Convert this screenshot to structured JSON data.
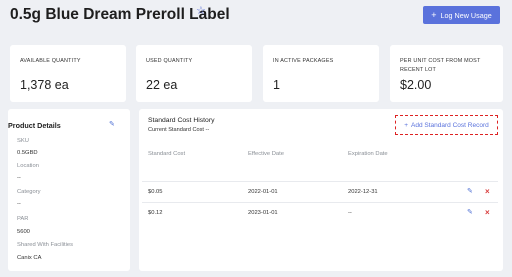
{
  "header": {
    "title": "0.5g Blue Dream Preroll Label",
    "star_icon": "star-outline-icon",
    "log_button_label": "Log New Usage"
  },
  "stats": [
    {
      "label": "AVAILABLE QUANTITY",
      "value": "1,378 ea"
    },
    {
      "label": "USED QUANTITY",
      "value": "22 ea"
    },
    {
      "label": "IN ACTIVE PACKAGES",
      "value": "1"
    },
    {
      "label": "PER UNIT COST FROM MOST RECENT LOT",
      "value": "$2.00"
    }
  ],
  "product_details": {
    "title": "Product Details",
    "fields": [
      {
        "label": "SKU",
        "value": "0.5GBD"
      },
      {
        "label": "Location",
        "value": "--"
      },
      {
        "label": "Category",
        "value": "--"
      },
      {
        "label": "PAR",
        "value": "5600"
      },
      {
        "label": "Shared With Facilities",
        "value": "Canix CA"
      }
    ]
  },
  "cost_history": {
    "title": "Standard Cost History",
    "subtitle": "Current Standard Cost --",
    "add_button_label": "Add Standard Cost Record",
    "columns": [
      "Standard Cost",
      "Effective Date",
      "Expiration Date"
    ],
    "rows": [
      {
        "cost": "$0.05",
        "effective": "2022-01-01",
        "expiration": "2022-12-31"
      },
      {
        "cost": "$0.12",
        "effective": "2023-01-01",
        "expiration": "--"
      }
    ]
  },
  "colors": {
    "accent": "#5a72dc",
    "danger": "#d83b3b",
    "background": "#eef0f4"
  }
}
